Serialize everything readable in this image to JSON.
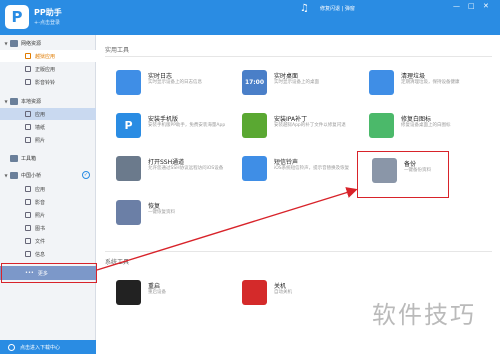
{
  "titlebar": {
    "logo": "P",
    "title": "PP助手",
    "login": "+-点击登录",
    "repair": "修复闪退 | 弹窗",
    "minimize": "—",
    "maximize": "□",
    "close": "✕"
  },
  "sidebar": {
    "network": "网络资源",
    "jailbreak": "越狱应用",
    "genuine": "正版应用",
    "ringtones_sub": "影音铃铃",
    "local": "本地资源",
    "apps": "应用",
    "wallpapers": "墙纸",
    "photos": "照片",
    "toolbox": "工具箱",
    "device": "中国小桥",
    "dev_apps": "应用",
    "dev_video": "影音",
    "dev_photos": "照片",
    "books": "图书",
    "files": "文件",
    "info": "信息",
    "more": "更多",
    "download": "点击进入下载中心"
  },
  "main": {
    "practical_tools": "实用工具",
    "system_tools": "系统工具",
    "tools": [
      {
        "name": "实时日志",
        "desc": "实时显示设备上的日志信息",
        "icon": "log-icon",
        "color": "#3f8ee6"
      },
      {
        "name": "实时桌面",
        "desc": "实时显示设备上的桌面",
        "icon": "desktop-icon",
        "color": "#4a7fc8",
        "time": "17:00"
      },
      {
        "name": "清理垃圾",
        "desc": "定期清理垃圾，保持设备健康",
        "icon": "broom-icon",
        "color": "#3f8ee6"
      },
      {
        "name": "安装手机版",
        "desc": "安装手机版PP助手，免费安装海量App",
        "icon": "pp-mobile-icon",
        "color": "#2a8ce3",
        "glyph": "P"
      },
      {
        "name": "安装IPA补丁",
        "desc": "安装越狱App的补丁文件以修复闪退",
        "icon": "puzzle-icon",
        "color": "#5aa832"
      },
      {
        "name": "修复白图标",
        "desc": "修复设备桌面上的白图标",
        "icon": "bandage-icon",
        "color": "#4bb96a"
      },
      {
        "name": "打开SSH通道",
        "desc": "允许您通过SSH协议远程访问iOS设备",
        "icon": "ssh-icon",
        "color": "#6b7a8c"
      },
      {
        "name": "短信铃声",
        "desc": "iOS系统短信铃声，提示音替换及恢复",
        "icon": "ringtone-icon",
        "color": "#3f8ee6"
      },
      {
        "name": "备份",
        "desc": "一键备份资料",
        "icon": "backup-icon",
        "color": "#8a96a8"
      },
      {
        "name": "恢复",
        "desc": "一键恢复资料",
        "icon": "restore-icon",
        "color": "#6b7fa6"
      },
      {
        "name": "重启",
        "desc": "重启设备",
        "icon": "restart-icon",
        "color": "#222222"
      },
      {
        "name": "关机",
        "desc": "自动关机",
        "icon": "power-icon",
        "color": "#d42a2a"
      }
    ]
  },
  "watermark": "软件技巧",
  "colors": {
    "accent": "#2a8ce3",
    "highlight": "#d8232a",
    "selected": "#7c98c9"
  }
}
